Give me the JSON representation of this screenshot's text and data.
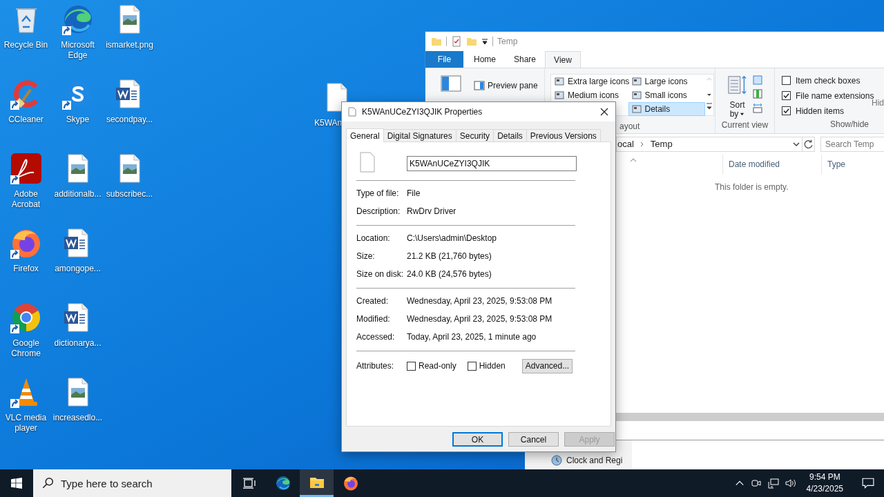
{
  "desktop_columns": [
    {
      "icons": [
        {
          "label": "Recycle Bin",
          "kind": "recycle",
          "shortcut": false
        },
        {
          "label": "CCleaner",
          "kind": "ccleaner",
          "shortcut": true
        },
        {
          "label": "Adobe Acrobat",
          "kind": "acrobat",
          "shortcut": true
        },
        {
          "label": "Firefox",
          "kind": "firefox",
          "shortcut": true
        },
        {
          "label": "Google Chrome",
          "kind": "chrome",
          "shortcut": true
        },
        {
          "label": "VLC media player",
          "kind": "vlc",
          "shortcut": true
        }
      ]
    },
    {
      "icons": [
        {
          "label": "Microsoft Edge",
          "kind": "edge",
          "shortcut": true
        },
        {
          "label": "Skype",
          "kind": "skype",
          "shortcut": true
        },
        {
          "label": "additionalb...",
          "kind": "image",
          "shortcut": false
        },
        {
          "label": "amongope...",
          "kind": "word",
          "shortcut": false
        },
        {
          "label": "dictionarya...",
          "kind": "word",
          "shortcut": false
        },
        {
          "label": "increasedlo...",
          "kind": "image",
          "shortcut": false
        }
      ]
    },
    {
      "icons": [
        {
          "label": "ismarket.png",
          "kind": "image",
          "shortcut": false
        },
        {
          "label": "secondpay...",
          "kind": "word",
          "shortcut": false
        },
        {
          "label": "subscribec...",
          "kind": "image",
          "shortcut": false
        }
      ]
    }
  ],
  "desktop_file": {
    "label": "K5WAn",
    "kind": "file",
    "shortcut": false
  },
  "explorer": {
    "title": "Temp",
    "tabs": [
      {
        "label": "File",
        "kind": "file",
        "selected": false
      },
      {
        "label": "Home",
        "kind": "tab",
        "selected": false
      },
      {
        "label": "Share",
        "kind": "tab",
        "selected": false
      },
      {
        "label": "View",
        "kind": "tab",
        "selected": true
      }
    ],
    "preview_pane": "Preview pane",
    "layout_options": [
      {
        "label": "Extra large icons",
        "selected": false
      },
      {
        "label": "Large icons",
        "selected": false
      },
      {
        "label": "Medium icons",
        "selected": false
      },
      {
        "label": "Small icons",
        "selected": false
      },
      {
        "label": "Details",
        "selected": true
      }
    ],
    "layout_group": "ayout",
    "sort_by": {
      "line_1": "Sort",
      "line_2": "by"
    },
    "current_view_group": "Current view",
    "show_hide": [
      {
        "label": "Item check boxes",
        "checked": false
      },
      {
        "label": "File name extensions",
        "checked": true
      },
      {
        "label": "Hidden items",
        "checked": true
      }
    ],
    "hide_partial": "Hid",
    "show_hide_group": "Show/hide",
    "address": [
      "ocal",
      "Temp"
    ],
    "search": {
      "placeholder": "Search Temp"
    },
    "columns": [
      "Date modified",
      "Type"
    ],
    "empty_message": "This folder is empty."
  },
  "control_panel": {
    "items": [
      "Clock and Regi"
    ]
  },
  "dialog": {
    "title": "K5WAnUCeZYI3QJIK Properties",
    "tabs": [
      {
        "label": "General",
        "selected": true
      },
      {
        "label": "Digital Signatures",
        "selected": false
      },
      {
        "label": "Security",
        "selected": false
      },
      {
        "label": "Details",
        "selected": false
      },
      {
        "label": "Previous Versions",
        "selected": false
      }
    ],
    "file_name": "K5WAnUCeZYI3QJIK",
    "sections": [
      [
        {
          "label": "Type of file:",
          "value": "File"
        },
        {
          "label": "Description:",
          "value": "RwDrv Driver"
        }
      ],
      [
        {
          "label": "Location:",
          "value": "C:\\Users\\admin\\Desktop"
        },
        {
          "label": "Size:",
          "value": "21.2 KB (21,760 bytes)"
        },
        {
          "label": "Size on disk:",
          "value": "24.0 KB (24,576 bytes)"
        }
      ],
      [
        {
          "label": "Created:",
          "value": "Wednesday, April 23, 2025, 9:53:08 PM"
        },
        {
          "label": "Modified:",
          "value": "Wednesday, April 23, 2025, 9:53:08 PM"
        },
        {
          "label": "Accessed:",
          "value": "Today, April 23, 2025, 1 minute ago"
        }
      ]
    ],
    "attributes_label": "Attributes:",
    "attributes": [
      {
        "label": "Read-only",
        "checked": false
      },
      {
        "label": "Hidden",
        "checked": false
      }
    ],
    "advanced": "Advanced...",
    "buttons": [
      {
        "label": "OK",
        "kind": "default",
        "disabled": false
      },
      {
        "label": "Cancel",
        "kind": "normal",
        "disabled": false
      },
      {
        "label": "Apply",
        "kind": "normal",
        "disabled": true
      }
    ]
  },
  "taskbar": {
    "search": {
      "placeholder": "Type here to search"
    },
    "apps": [
      {
        "kind": "task-view",
        "active": false
      },
      {
        "kind": "edge",
        "active": false
      },
      {
        "kind": "explorer",
        "active": true
      },
      {
        "kind": "firefox",
        "active": false
      }
    ],
    "clock": {
      "time": "9:54 PM",
      "date": "4/23/2025"
    }
  }
}
